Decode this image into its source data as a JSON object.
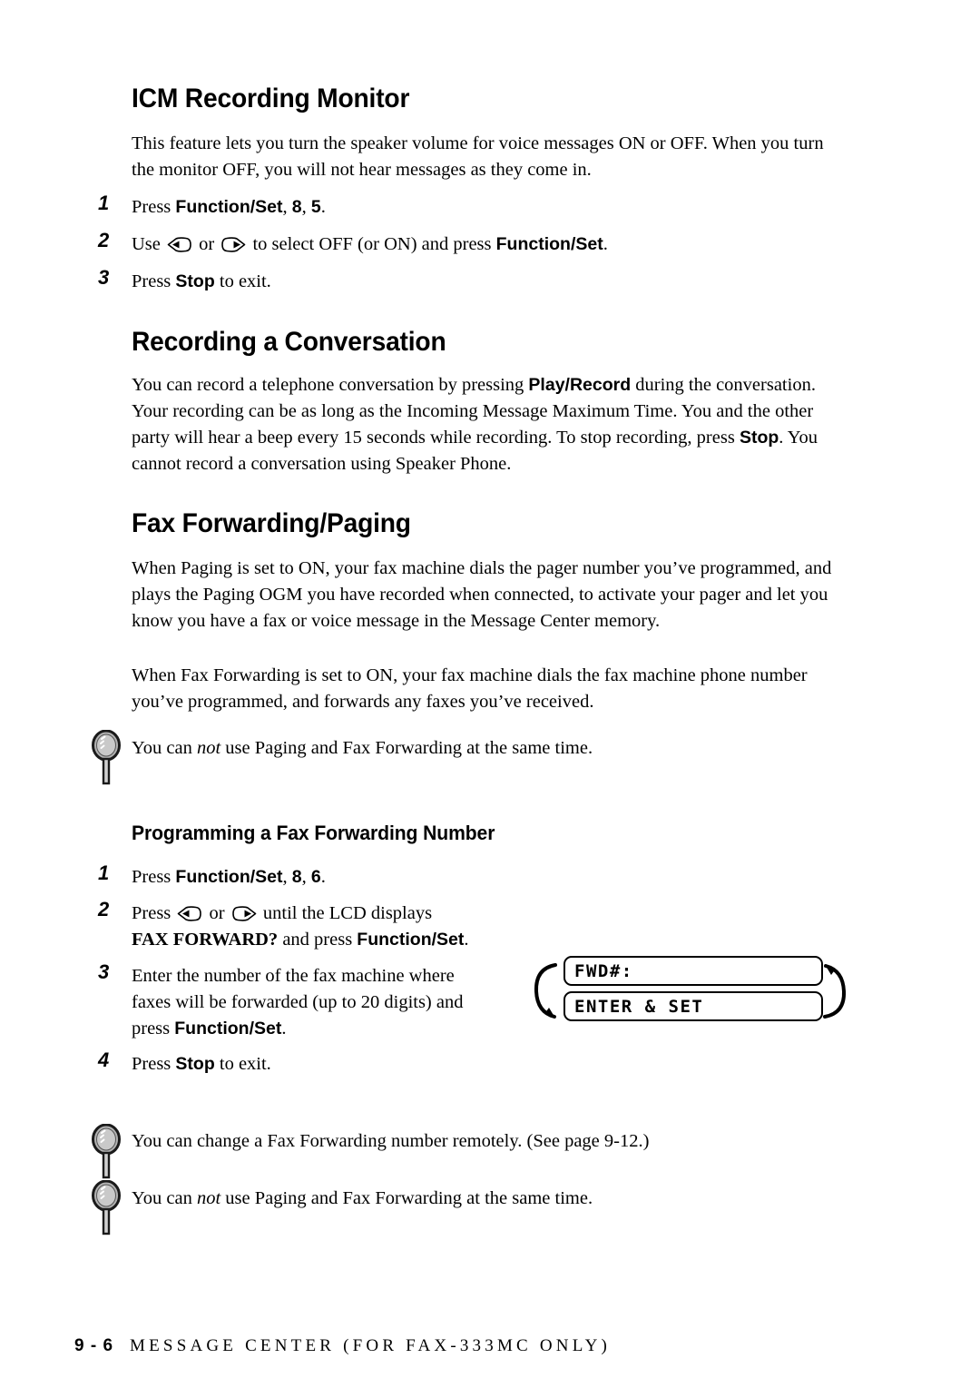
{
  "document": {
    "page_number": "9 - 6",
    "footer_title": "MESSAGE CENTER (FOR FAX-333MC ONLY)"
  },
  "sections": {
    "icm": {
      "heading": "ICM Recording Monitor",
      "intro": "This feature lets you turn the speaker volume for voice messages ON or OFF. When you turn the monitor OFF, you will not hear messages as they come in.",
      "steps": [
        {
          "number": "1",
          "pre": "Press ",
          "bold1": "Function/Set",
          "mid": ", ",
          "bold2": "8",
          "mid2": ", ",
          "bold3": "5",
          "post": "."
        },
        {
          "number": "2",
          "pre": "Use ",
          "mid": " or ",
          "mid2": " to select OFF (or ON) and press ",
          "bold1": "Function/Set",
          "post": "."
        },
        {
          "number": "3",
          "pre": "Press ",
          "bold1": "Stop",
          "post": " to exit."
        }
      ]
    },
    "recording_conversation": {
      "heading": "Recording a Conversation",
      "body_1": "You can record a telephone conversation by pressing ",
      "body_bold_1": "Play/Record",
      "body_2": " during the conversation. Your recording can be as long as the Incoming Message Maximum Time. You and the other party will hear a beep every 15 seconds while recording. To stop recording, press ",
      "body_bold_2": "Stop",
      "body_3": ". You cannot record a conversation using Speaker Phone."
    },
    "fax_forwarding": {
      "heading": "Fax Forwarding/Paging",
      "paragraph_1": "When Paging is set to ON, your fax machine dials the pager number you’ve programmed, and plays the Paging OGM you have recorded when connected, to activate your pager and let you know you have a fax or voice message in the Message Center memory.",
      "paragraph_2": "When Fax Forwarding is set to ON, your fax machine dials the fax machine phone number you’ve programmed, and forwards any faxes you’ve received.",
      "note_1": {
        "pre": "You can ",
        "italic": "not",
        "post": " use Paging and Fax Forwarding at the same time."
      }
    },
    "programming": {
      "heading": "Programming a Fax Forwarding Number",
      "steps": [
        {
          "number": "1",
          "pre": "Press ",
          "bold1": "Function/Set",
          "mid": ", ",
          "bold2": "8",
          "mid2": ", ",
          "bold3": "6",
          "post": "."
        },
        {
          "number": "2",
          "pre": "Press ",
          "mid": " or ",
          "mid2": " until the LCD displays",
          "line2_bold_serif": "FAX FORWARD?",
          "line2_mid": " and press ",
          "line2_bold_sans": "Function/Set",
          "line2_post": "."
        },
        {
          "number": "3",
          "line1": "Enter the number of the fax machine where",
          "line2": "faxes will be forwarded (up to 20 digits) and",
          "line3_pre": "press ",
          "line3_bold": "Function/Set",
          "line3_post": "."
        },
        {
          "number": "4",
          "pre": "Press ",
          "bold1": "Stop",
          "post": " to exit."
        }
      ],
      "lcd": {
        "line_1": "FWD#:",
        "line_2": "ENTER & SET"
      },
      "note_2": {
        "text": "You can change a Fax Forwarding number remotely. (See page 9-12.)"
      },
      "note_3": {
        "pre": "You can ",
        "italic": "not",
        "post": " use Paging and Fax Forwarding at the same time."
      }
    }
  },
  "icons": {
    "left_arrow_key": "left-arrow-key-icon",
    "right_arrow_key": "right-arrow-key-icon",
    "note": "magnifier-note-icon",
    "lcd_flow_down": "curved-arrow-down-icon",
    "lcd_flow_up": "curved-arrow-up-icon"
  },
  "colors": {
    "ink": "#000000",
    "paper": "#ffffff",
    "lens_gray": "#b3b3b3"
  }
}
